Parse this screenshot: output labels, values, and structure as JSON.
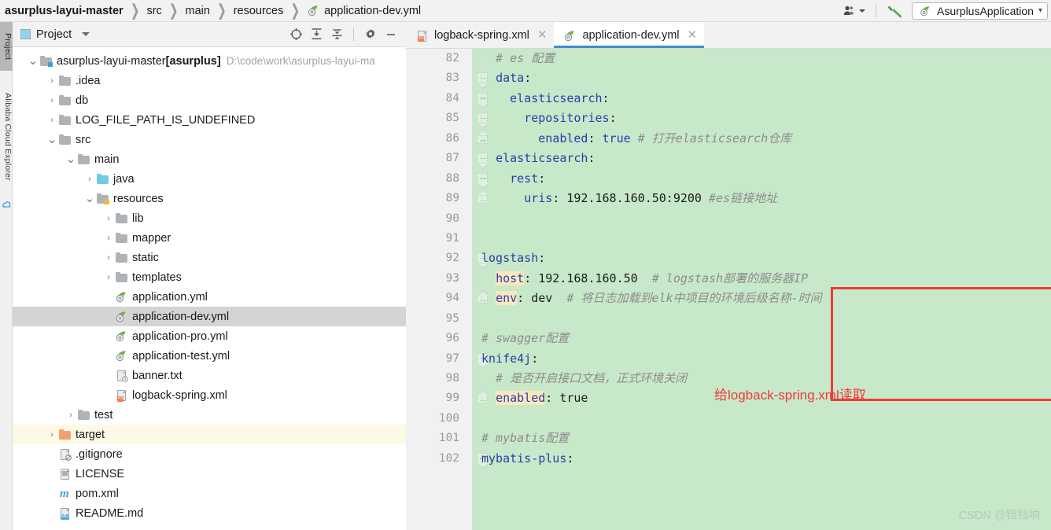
{
  "breadcrumb": {
    "items": [
      "asurplus-layui-master",
      "src",
      "main",
      "resources"
    ],
    "file": "application-dev.yml",
    "separator": "❯"
  },
  "toolbar_right": {
    "people_icon": "people-icon",
    "build_icon": "hammer-icon",
    "run_config": "AsurplusApplication",
    "run_config_caret": "▾"
  },
  "vertical_tabs": [
    {
      "label": "Project",
      "active": true
    },
    {
      "label": "Alibaba Cloud Explorer",
      "active": false
    }
  ],
  "project_panel": {
    "title": "Project",
    "caret": "▾",
    "tools": [
      "locate-icon",
      "expand-all-icon",
      "collapse-all-icon",
      "settings-icon",
      "hide-icon"
    ]
  },
  "tree": [
    {
      "depth": 0,
      "arrow": "⌄",
      "icon": "folder-module",
      "label": "asurplus-layui-master",
      "tag": "[asurplus]",
      "path": "D:\\code\\work\\asurplus-layui-ma",
      "state": "normal"
    },
    {
      "depth": 1,
      "arrow": "›",
      "icon": "folder",
      "label": ".idea",
      "state": "normal"
    },
    {
      "depth": 1,
      "arrow": "›",
      "icon": "folder",
      "label": "db",
      "state": "normal"
    },
    {
      "depth": 1,
      "arrow": "›",
      "icon": "folder",
      "label": "LOG_FILE_PATH_IS_UNDEFINED",
      "state": "normal"
    },
    {
      "depth": 1,
      "arrow": "⌄",
      "icon": "folder",
      "label": "src",
      "state": "normal"
    },
    {
      "depth": 2,
      "arrow": "⌄",
      "icon": "folder",
      "label": "main",
      "state": "normal"
    },
    {
      "depth": 3,
      "arrow": "›",
      "icon": "folder-source",
      "label": "java",
      "state": "normal"
    },
    {
      "depth": 3,
      "arrow": "⌄",
      "icon": "folder-resources",
      "label": "resources",
      "state": "normal"
    },
    {
      "depth": 4,
      "arrow": "›",
      "icon": "folder",
      "label": "lib",
      "state": "normal"
    },
    {
      "depth": 4,
      "arrow": "›",
      "icon": "folder",
      "label": "mapper",
      "state": "normal"
    },
    {
      "depth": 4,
      "arrow": "›",
      "icon": "folder",
      "label": "static",
      "state": "normal"
    },
    {
      "depth": 4,
      "arrow": "›",
      "icon": "folder",
      "label": "templates",
      "state": "normal"
    },
    {
      "depth": 4,
      "arrow": "",
      "icon": "spring-yml",
      "label": "application.yml",
      "state": "normal"
    },
    {
      "depth": 4,
      "arrow": "",
      "icon": "spring-yml",
      "label": "application-dev.yml",
      "state": "selected"
    },
    {
      "depth": 4,
      "arrow": "",
      "icon": "spring-yml",
      "label": "application-pro.yml",
      "state": "normal"
    },
    {
      "depth": 4,
      "arrow": "",
      "icon": "spring-yml",
      "label": "application-test.yml",
      "state": "normal"
    },
    {
      "depth": 4,
      "arrow": "",
      "icon": "file-txt",
      "label": "banner.txt",
      "state": "normal"
    },
    {
      "depth": 4,
      "arrow": "",
      "icon": "file-xml",
      "label": "logback-spring.xml",
      "state": "normal"
    },
    {
      "depth": 2,
      "arrow": "›",
      "icon": "folder",
      "label": "test",
      "state": "normal"
    },
    {
      "depth": 1,
      "arrow": "›",
      "icon": "folder-excluded",
      "label": "target",
      "state": "excluded"
    },
    {
      "depth": 1,
      "arrow": "",
      "icon": "file-git",
      "label": ".gitignore",
      "state": "normal"
    },
    {
      "depth": 1,
      "arrow": "",
      "icon": "file-plain",
      "label": "LICENSE",
      "state": "normal"
    },
    {
      "depth": 1,
      "arrow": "",
      "icon": "file-maven",
      "label": "pom.xml",
      "state": "normal"
    },
    {
      "depth": 1,
      "arrow": "",
      "icon": "file-md",
      "label": "README.md",
      "state": "normal"
    }
  ],
  "editor_tabs": [
    {
      "label": "logback-spring.xml",
      "icon": "file-xml",
      "active": false,
      "close": "✕"
    },
    {
      "label": "application-dev.yml",
      "icon": "spring-yml",
      "active": true,
      "close": "✕"
    }
  ],
  "code": {
    "first_line": 82,
    "lines": [
      {
        "n": 82,
        "fold": "none",
        "indent": 1,
        "parts": [
          {
            "t": "  # es 配置",
            "c": "cm"
          }
        ]
      },
      {
        "n": 83,
        "fold": "open",
        "indent": 1,
        "parts": [
          {
            "t": "  ",
            "c": "v"
          },
          {
            "t": "data",
            "c": "k"
          },
          {
            "t": ":",
            "c": "v"
          }
        ]
      },
      {
        "n": 84,
        "fold": "open",
        "indent": 2,
        "parts": [
          {
            "t": "    ",
            "c": "v"
          },
          {
            "t": "elasticsearch",
            "c": "k"
          },
          {
            "t": ":",
            "c": "v"
          }
        ]
      },
      {
        "n": 85,
        "fold": "open",
        "indent": 3,
        "parts": [
          {
            "t": "      ",
            "c": "v"
          },
          {
            "t": "repositories",
            "c": "k"
          },
          {
            "t": ":",
            "c": "v"
          }
        ]
      },
      {
        "n": 86,
        "fold": "end",
        "indent": 4,
        "parts": [
          {
            "t": "        ",
            "c": "v"
          },
          {
            "t": "enabled",
            "c": "k"
          },
          {
            "t": ": ",
            "c": "v"
          },
          {
            "t": "true",
            "c": "k"
          },
          {
            "t": " # 打开elasticsearch仓库",
            "c": "cm"
          }
        ]
      },
      {
        "n": 87,
        "fold": "open",
        "indent": 1,
        "parts": [
          {
            "t": "  ",
            "c": "v"
          },
          {
            "t": "elasticsearch",
            "c": "k"
          },
          {
            "t": ":",
            "c": "v"
          }
        ]
      },
      {
        "n": 88,
        "fold": "open",
        "indent": 2,
        "parts": [
          {
            "t": "    ",
            "c": "v"
          },
          {
            "t": "rest",
            "c": "k"
          },
          {
            "t": ":",
            "c": "v"
          }
        ]
      },
      {
        "n": 89,
        "fold": "end",
        "indent": 3,
        "parts": [
          {
            "t": "      ",
            "c": "v"
          },
          {
            "t": "uris",
            "c": "k"
          },
          {
            "t": ": ",
            "c": "v"
          },
          {
            "t": "192.168.160.50:9200",
            "c": "v"
          },
          {
            "t": " #es链接地址",
            "c": "cm"
          }
        ]
      },
      {
        "n": 90,
        "fold": "none",
        "indent": 0,
        "parts": []
      },
      {
        "n": 91,
        "fold": "none",
        "indent": 0,
        "parts": []
      },
      {
        "n": 92,
        "fold": "open",
        "indent": 0,
        "parts": [
          {
            "t": "logstash",
            "c": "k"
          },
          {
            "t": ":",
            "c": "v"
          }
        ]
      },
      {
        "n": 93,
        "fold": "none",
        "indent": 1,
        "parts": [
          {
            "t": "  ",
            "c": "v"
          },
          {
            "t": "host",
            "c": "k hl"
          },
          {
            "t": ": ",
            "c": "v"
          },
          {
            "t": "192.168.160.50",
            "c": "v"
          },
          {
            "t": "  # logstash部署的服务器IP",
            "c": "cm"
          }
        ]
      },
      {
        "n": 94,
        "fold": "end",
        "indent": 1,
        "parts": [
          {
            "t": "  ",
            "c": "v"
          },
          {
            "t": "env",
            "c": "k hl"
          },
          {
            "t": ": ",
            "c": "v"
          },
          {
            "t": "dev",
            "c": "v"
          },
          {
            "t": "  # 将日志加载到elk中项目的环境后级名称-时间",
            "c": "cm"
          }
        ]
      },
      {
        "n": 95,
        "fold": "none",
        "indent": 0,
        "parts": []
      },
      {
        "n": 96,
        "fold": "none",
        "indent": 0,
        "parts": [
          {
            "t": "# swagger配置",
            "c": "cm"
          }
        ]
      },
      {
        "n": 97,
        "fold": "open",
        "indent": 0,
        "parts": [
          {
            "t": "knife4j",
            "c": "k"
          },
          {
            "t": ":",
            "c": "v"
          }
        ]
      },
      {
        "n": 98,
        "fold": "none",
        "indent": 1,
        "parts": [
          {
            "t": "  # 是否开启接口文档，正式环境关闭",
            "c": "cm"
          }
        ]
      },
      {
        "n": 99,
        "fold": "end",
        "indent": 1,
        "parts": [
          {
            "t": "  ",
            "c": "v"
          },
          {
            "t": "enabled",
            "c": "k hl"
          },
          {
            "t": ": ",
            "c": "v"
          },
          {
            "t": "true",
            "c": "v"
          }
        ]
      },
      {
        "n": 100,
        "fold": "none",
        "indent": 0,
        "parts": []
      },
      {
        "n": 101,
        "fold": "none",
        "indent": 0,
        "parts": [
          {
            "t": "# mybatis配置",
            "c": "cm"
          }
        ]
      },
      {
        "n": 102,
        "fold": "open",
        "indent": 0,
        "parts": [
          {
            "t": "mybatis-plus",
            "c": "k"
          },
          {
            "t": ":",
            "c": "v"
          }
        ]
      }
    ]
  },
  "annotation": {
    "text": "给logback-spring.xml读取",
    "color": "#ef3a3a"
  },
  "watermark": "CSDN @铛铛响",
  "colors": {
    "editor_added_bg": "#c8e8ca",
    "key": "#2a3ea8",
    "comment": "#8c8c8c",
    "highlight": "#fae7c0",
    "accent": "#3c8fd4",
    "annotation": "#ef3a3a"
  }
}
